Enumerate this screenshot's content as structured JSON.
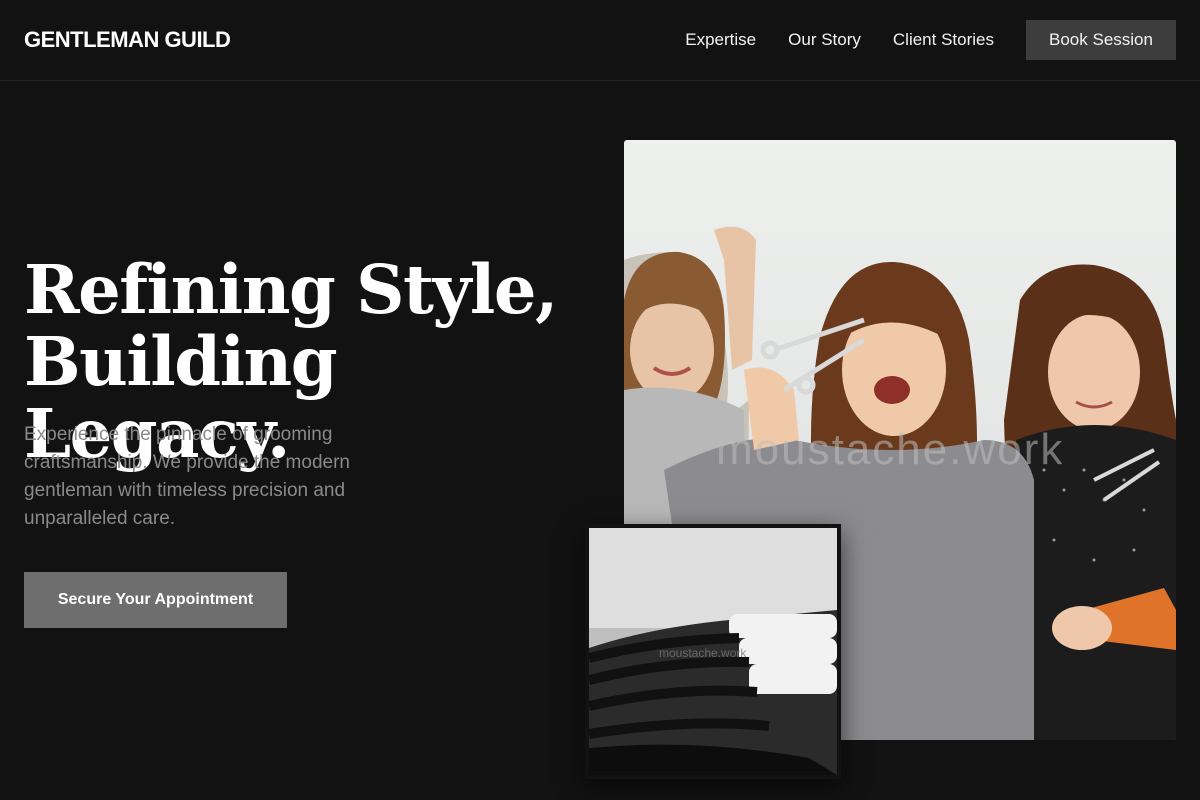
{
  "header": {
    "brand": "GENTLEMAN GUILD",
    "nav": [
      {
        "label": "Expertise"
      },
      {
        "label": "Our Story"
      },
      {
        "label": "Client Stories"
      }
    ],
    "book_button": "Book Session"
  },
  "hero": {
    "headline_line1": "Refining Style,",
    "headline_line2": "Building Legacy.",
    "description": "Experience the pinnacle of grooming craftsmanship. We provide the modern gentleman with timeless precision and unparalleled care.",
    "cta_label": "Secure Your Appointment"
  },
  "images": {
    "main_photo": {
      "subject": "three-stylists-with-scissors-photo",
      "watermark": "moustache.work"
    },
    "inset_photo": {
      "subject": "salon-wash-basins-photo",
      "watermark": "moustache.work"
    }
  },
  "colors": {
    "background": "#121212",
    "book_button_bg": "#3d3d3d",
    "cta_bg": "#6e6e6e",
    "subtext": "#8a8a8a"
  }
}
